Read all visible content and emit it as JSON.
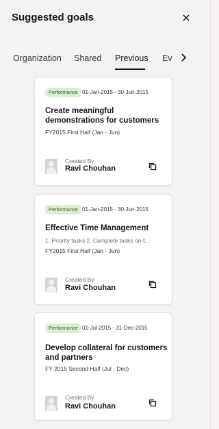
{
  "panel": {
    "title": "Suggested goals",
    "close_icon": "close-icon"
  },
  "tabs": [
    {
      "label": "Organization",
      "active": false
    },
    {
      "label": "Shared",
      "active": false
    },
    {
      "label": "Previous",
      "active": true
    },
    {
      "label": "Ev",
      "active": false
    }
  ],
  "goals": [
    {
      "badge": "Performance",
      "dates": "01-Jan-2015 - 30-Jun-2015",
      "title": "Create meaningful demonstrations for customers",
      "description": "",
      "period": "FY2015 First Half (Jan - Jun)",
      "created_by_label": "Created By",
      "created_by": "Ravi Chouhan"
    },
    {
      "badge": "Performance",
      "dates": "01-Jan-2015 - 30-Jun-2015",
      "title": "Effective Time Management",
      "description": "1. Priority tasks 2. Complete tasks on-t...",
      "period": "FY2015 First Half (Jan - Jun)",
      "created_by_label": "Created By",
      "created_by": "Ravi Chouhan"
    },
    {
      "badge": "Performance",
      "dates": "01-Jul-2015 - 31-Dec-2015",
      "title": "Develop collateral for customers and partners",
      "description": "",
      "period": "FY 2015 Second Half (Jul - Dec)",
      "created_by_label": "Created By",
      "created_by": "Ravi Chouhan"
    }
  ],
  "colors": {
    "badge_bg": "#dbeed3",
    "badge_text": "#2f5e25",
    "panel_bg": "#f5f3f1",
    "card_bg": "#ffffff"
  }
}
